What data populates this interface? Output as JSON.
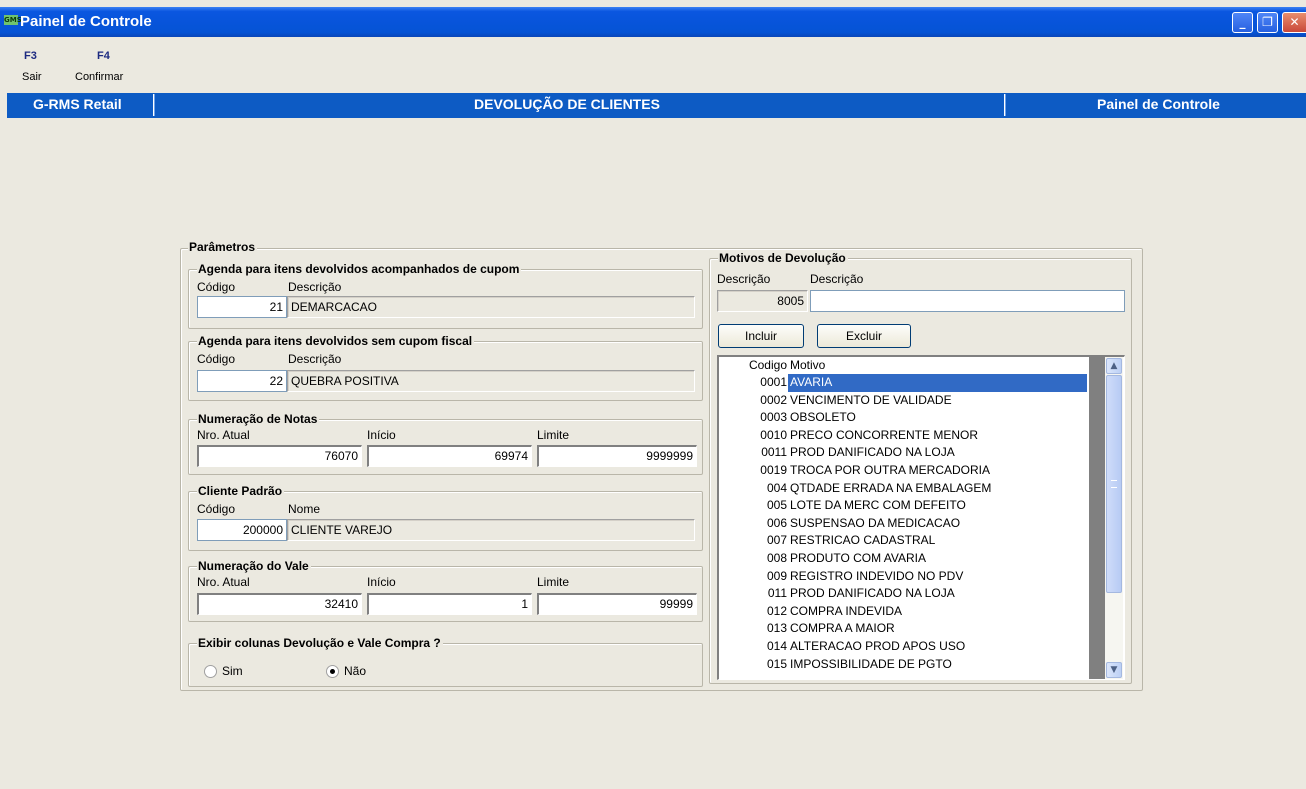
{
  "window": {
    "title": "Painel de Controle",
    "icon_text": "GMS",
    "controls": {
      "minimize": "_",
      "restore": "❐",
      "close": "✕"
    }
  },
  "function_keys": [
    {
      "key": "F3",
      "label": "Sair"
    },
    {
      "key": "F4",
      "label": "Confirmar"
    }
  ],
  "header": {
    "left": "G-RMS Retail",
    "center": "DEVOLUÇÃO DE CLIENTES",
    "right": "Painel de Controle"
  },
  "parametros": {
    "title": "Parâmetros",
    "agenda_com_cupom": {
      "title": "Agenda para itens devolvidos acompanhados de cupom",
      "codigo_label": "Código",
      "descricao_label": "Descrição",
      "codigo": "21",
      "descricao": "DEMARCACAO"
    },
    "agenda_sem_cupom": {
      "title": "Agenda para itens devolvidos sem cupom fiscal",
      "codigo_label": "Código",
      "descricao_label": "Descrição",
      "codigo": "22",
      "descricao": "QUEBRA POSITIVA"
    },
    "numeracao_notas": {
      "title": "Numeração de Notas",
      "atual_label": "Nro. Atual",
      "inicio_label": "Início",
      "limite_label": "Limite",
      "atual": "76070",
      "inicio": "69974",
      "limite": "9999999"
    },
    "cliente_padrao": {
      "title": "Cliente Padrão",
      "codigo_label": "Código",
      "nome_label": "Nome",
      "codigo": "200000",
      "nome": "CLIENTE VAREJO"
    },
    "numeracao_vale": {
      "title": "Numeração do Vale",
      "atual_label": "Nro. Atual",
      "inicio_label": "Início",
      "limite_label": "Limite",
      "atual": "32410",
      "inicio": "1",
      "limite": "99999"
    },
    "exibir_colunas": {
      "title": "Exibir colunas Devolução e Vale Compra ?",
      "options": [
        "Sim",
        "Não"
      ],
      "selected": "Não"
    }
  },
  "motivos": {
    "title": "Motivos de Devolução",
    "codigo_label": "Descrição",
    "descricao_label": "Descrição",
    "codigo": "8005",
    "descricao": "",
    "incluir_label": "Incluir",
    "excluir_label": "Excluir",
    "columns": [
      "Codigo",
      "Motivo"
    ],
    "rows": [
      {
        "codigo": "0001",
        "motivo": "AVARIA",
        "selected": true
      },
      {
        "codigo": "0002",
        "motivo": "VENCIMENTO DE VALIDADE"
      },
      {
        "codigo": "0003",
        "motivo": "OBSOLETO"
      },
      {
        "codigo": "0010",
        "motivo": "PRECO CONCORRENTE MENOR"
      },
      {
        "codigo": "0011",
        "motivo": "PROD DANIFICADO NA LOJA"
      },
      {
        "codigo": "0019",
        "motivo": "TROCA  POR  OUTRA  MERCADORIA"
      },
      {
        "codigo": "004",
        "motivo": "QTDADE ERRADA NA EMBALAGEM"
      },
      {
        "codigo": "005",
        "motivo": "LOTE DA MERC COM DEFEITO"
      },
      {
        "codigo": "006",
        "motivo": "SUSPENSAO DA MEDICACAO"
      },
      {
        "codigo": "007",
        "motivo": "RESTRICAO CADASTRAL"
      },
      {
        "codigo": "008",
        "motivo": "PRODUTO COM AVARIA"
      },
      {
        "codigo": "009",
        "motivo": "REGISTRO INDEVIDO NO PDV"
      },
      {
        "codigo": "011",
        "motivo": "PROD DANIFICADO NA LOJA"
      },
      {
        "codigo": "012",
        "motivo": "COMPRA INDEVIDA"
      },
      {
        "codigo": "013",
        "motivo": "COMPRA A MAIOR"
      },
      {
        "codigo": "014",
        "motivo": "ALTERACAO PROD APOS USO"
      },
      {
        "codigo": "015",
        "motivo": "IMPOSSIBILIDADE DE PGTO"
      }
    ]
  },
  "colors": {
    "titlebar": "#0553d5",
    "header_strip": "#0d5bc4",
    "selection": "#316ac5",
    "window_bg": "#ebe9e0"
  }
}
